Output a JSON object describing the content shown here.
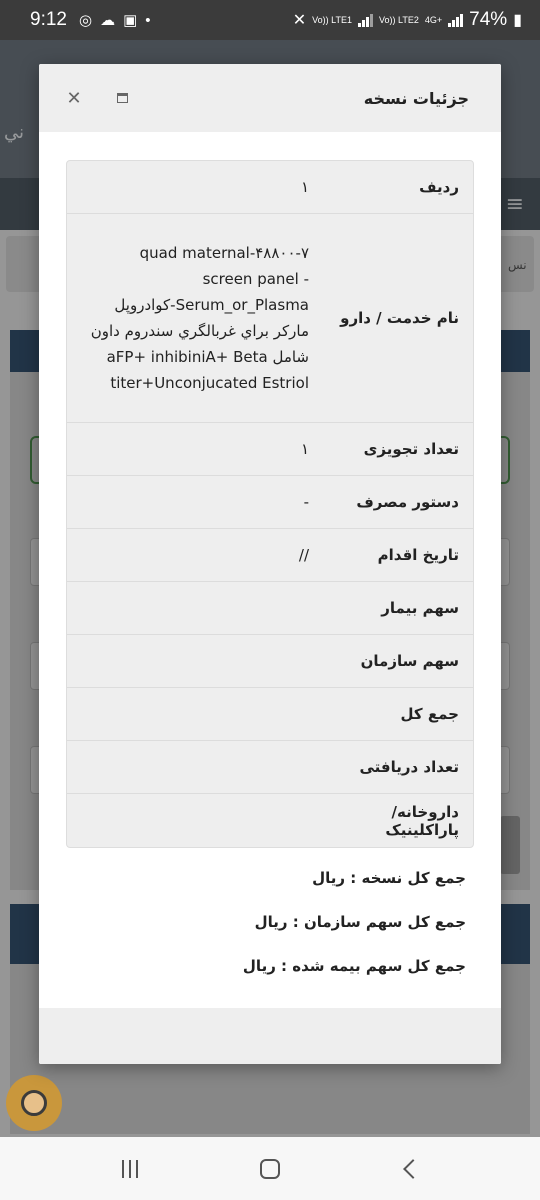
{
  "status_bar": {
    "time": "9:12",
    "network_1": "Vo)) LTE1",
    "network_2": "Vo)) LTE2",
    "network_type": "4G+",
    "battery": "74%"
  },
  "modal": {
    "title": "جزئیات نسخه",
    "rows": [
      {
        "label": "ردیف",
        "value": "۱"
      },
      {
        "label": "نام خدمت / دارو",
        "value": "quad maternal-۴۸۸۰۰-۷ screen panel - Serum_or_Plasma-کوادروپل مارکر براي غربالگري سندروم داون شامل aFP+ inhibiniA+ Beta titer+Unconjucated Estriol"
      },
      {
        "label": "تعداد تجویزی",
        "value": "۱"
      },
      {
        "label": "دستور مصرف",
        "value": "-"
      },
      {
        "label": "تاریخ اقدام",
        "value": "//"
      },
      {
        "label": "سهم بیمار",
        "value": ""
      },
      {
        "label": "سهم سازمان",
        "value": ""
      },
      {
        "label": "جمع کل",
        "value": ""
      },
      {
        "label": "تعداد دریافتی",
        "value": ""
      },
      {
        "label": "داروخانه/پاراکلینیک",
        "value": ""
      }
    ],
    "summary": [
      "جمع کل نسخه : ریال",
      "جمع کل سهم سازمان : ریال",
      "جمع کل سهم بیمه شده : ریال"
    ]
  },
  "background_app": {
    "header_partial_left": "ني",
    "edge_text_1": "نس",
    "edge_text_2": "ج"
  },
  "icons": {
    "close": "close-icon",
    "maximize": "maximize-icon",
    "menu": "hamburger-icon"
  }
}
